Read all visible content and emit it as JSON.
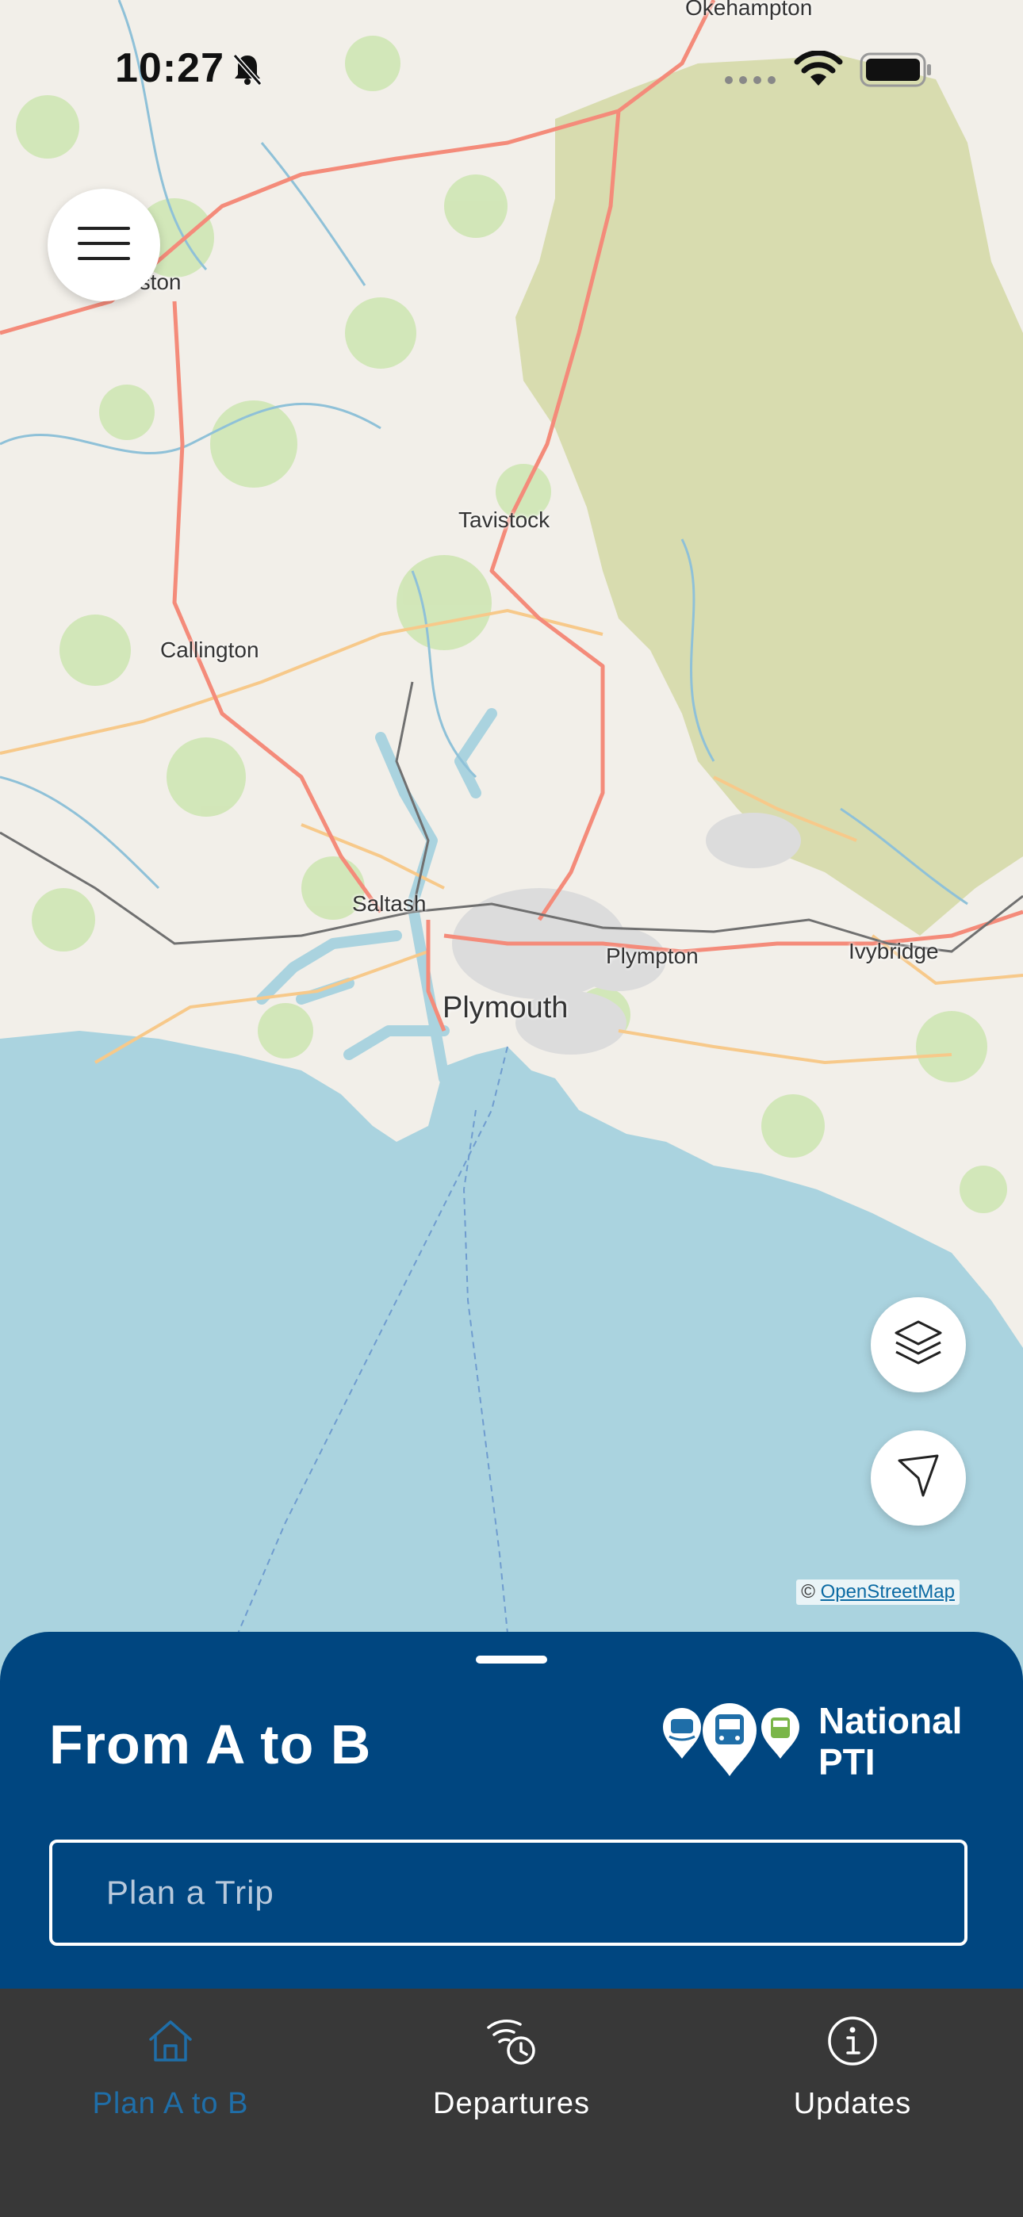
{
  "status_bar": {
    "time": "10:27"
  },
  "map": {
    "attribution_symbol": "©",
    "attribution_link": "OpenStreetMap",
    "places": {
      "okehampton": "Okehampton",
      "tavistock": "Tavistock",
      "callington": "Callington",
      "saltash": "Saltash",
      "plymouth": "Plymouth",
      "plympton": "Plympton",
      "ivybridge": "Ivybridge",
      "launceston_partial": "eston"
    }
  },
  "sheet": {
    "title": "From A to B",
    "brand_line1": "National",
    "brand_line2": "PTI",
    "search_placeholder": "Plan a Trip"
  },
  "tabs": [
    {
      "label": "Plan A to B",
      "icon": "home-icon",
      "active": true
    },
    {
      "label": "Departures",
      "icon": "departures-icon",
      "active": false
    },
    {
      "label": "Updates",
      "icon": "info-icon",
      "active": false
    }
  ],
  "colors": {
    "sheet_bg": "#004680",
    "tabbar_bg": "#383838",
    "active_tab": "#1f6ea8",
    "sea": "#aad3df",
    "land": "#f2efe9",
    "moor": "#d8dcaf",
    "road_primary": "#f48b7a",
    "road_secondary": "#f7c98a"
  }
}
